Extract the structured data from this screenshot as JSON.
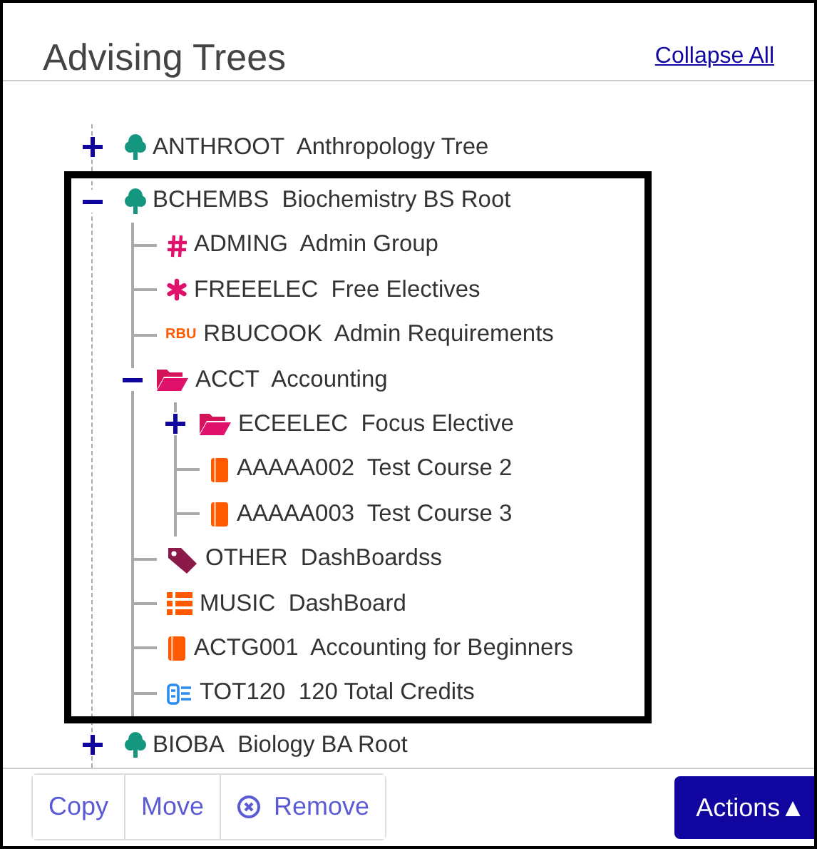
{
  "panel": {
    "title": "Advising Trees",
    "collapse_link": "Collapse All"
  },
  "tree": [
    {
      "code": "ANTHROOT",
      "name": "Anthropology Tree",
      "kind": "tree",
      "expanded": false,
      "selected": false
    },
    {
      "code": "BCHEMBS",
      "name": "Biochemistry BS Root",
      "kind": "tree",
      "expanded": true,
      "selected": true,
      "children": [
        {
          "code": "ADMING",
          "name": "Admin Group",
          "kind": "hash",
          "selected": false
        },
        {
          "code": "FREEELEC",
          "name": "Free Electives",
          "kind": "asterisk",
          "selected": false
        },
        {
          "code": "RBUCOOK",
          "name": "Admin Requirements",
          "kind": "rule",
          "badge": "RBU",
          "selected": false
        },
        {
          "code": "ACCT",
          "name": "Accounting",
          "kind": "folder",
          "expanded": true,
          "selected": false,
          "children": [
            {
              "code": "ECEELEC",
              "name": "Focus Elective",
              "kind": "folder",
              "expanded": false,
              "selected": false
            },
            {
              "code": "AAAAA002",
              "name": "Test Course 2",
              "kind": "book",
              "selected": false
            },
            {
              "code": "AAAAA003",
              "name": "Test Course 3",
              "kind": "book",
              "selected": false
            }
          ]
        },
        {
          "code": "OTHER",
          "name": "DashBoardss",
          "kind": "tag",
          "selected": false
        },
        {
          "code": "MUSIC",
          "name": "DashBoard",
          "kind": "list",
          "selected": false
        },
        {
          "code": "ACTG001",
          "name": "Accounting for Beginners",
          "kind": "book",
          "selected": false
        },
        {
          "code": "TOT120",
          "name": "120 Total Credits",
          "kind": "credits",
          "selected": false
        }
      ]
    },
    {
      "code": "BIOBA",
      "name": "Biology BA Root",
      "kind": "tree",
      "expanded": false,
      "selected": false
    }
  ],
  "footer": {
    "buttons": [
      {
        "label": "Copy",
        "kind": "plain"
      },
      {
        "label": "Move",
        "kind": "plain"
      },
      {
        "label": "Remove",
        "kind": "remove"
      }
    ],
    "actions": {
      "label": "Actions",
      "caret": "▲"
    }
  }
}
